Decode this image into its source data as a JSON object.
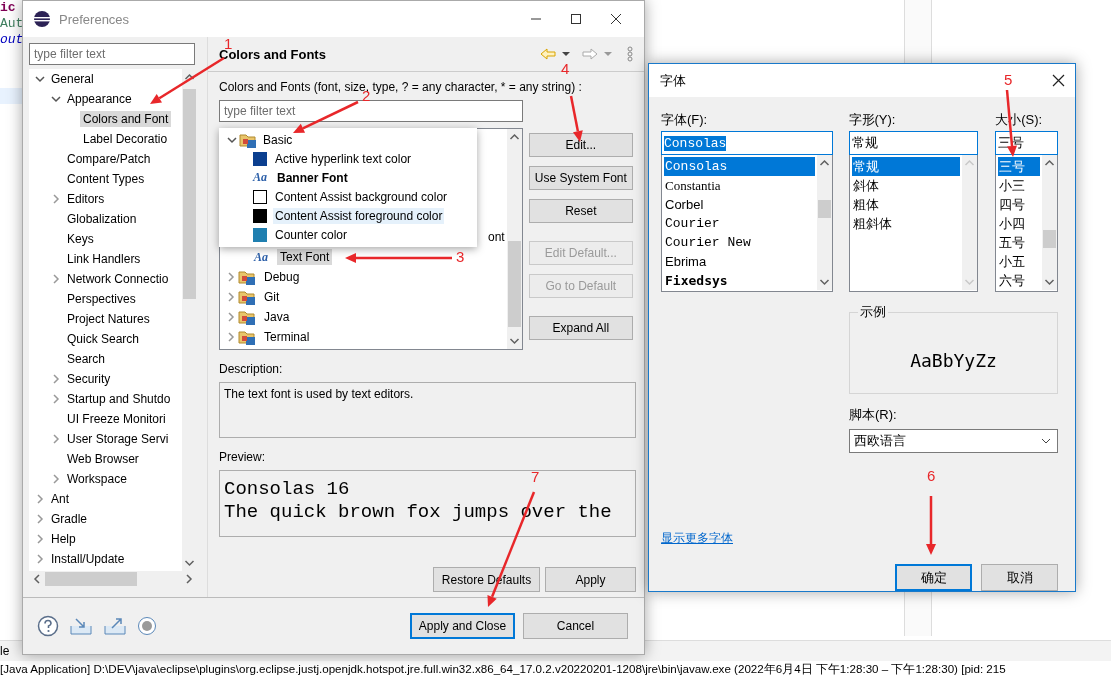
{
  "editor": {
    "code_fragments": [
      {
        "text": "ic",
        "kind": "keyword"
      },
      {
        "text": "Aut",
        "kind": "comment"
      },
      {
        "text": "out",
        "kind": "field"
      }
    ],
    "console_tab": "le",
    "console_line": "[Java Application] D:\\DEV\\java\\eclipse\\plugins\\org.eclipse.justj.openjdk.hotspot.jre.full.win32.x86_64_17.0.2.v20220201-1208\\jre\\bin\\javaw.exe  (2022年6月4日 下午1:28:30 – 下午1:28:30) [pid: 215"
  },
  "preferences": {
    "title": "Preferences",
    "filter": {
      "placeholder": "type filter text"
    },
    "tree": [
      {
        "label": "General",
        "selected": false,
        "expanded": true,
        "children": [
          {
            "label": "Appearance",
            "selected": false,
            "expanded": true,
            "children": [
              {
                "label": "Colors and Font",
                "selected": true
              },
              {
                "label": "Label Decoratio",
                "selected": false
              }
            ]
          },
          {
            "label": "Compare/Patch",
            "selected": false
          },
          {
            "label": "Content Types",
            "selected": false
          },
          {
            "label": "Editors",
            "selected": false,
            "expanded": false
          },
          {
            "label": "Globalization",
            "selected": false
          },
          {
            "label": "Keys",
            "selected": false
          },
          {
            "label": "Link Handlers",
            "selected": false
          },
          {
            "label": "Network Connectio",
            "selected": false,
            "expanded": false
          },
          {
            "label": "Perspectives",
            "selected": false
          },
          {
            "label": "Project Natures",
            "selected": false
          },
          {
            "label": "Quick Search",
            "selected": false
          },
          {
            "label": "Search",
            "selected": false
          },
          {
            "label": "Security",
            "selected": false,
            "expanded": false
          },
          {
            "label": "Startup and Shutdo",
            "selected": false,
            "expanded": false
          },
          {
            "label": "UI Freeze Monitori",
            "selected": false
          },
          {
            "label": "User Storage Servi",
            "selected": false,
            "expanded": false
          },
          {
            "label": "Web Browser",
            "selected": false
          },
          {
            "label": "Workspace",
            "selected": false,
            "expanded": false
          }
        ]
      },
      {
        "label": "Ant",
        "selected": false,
        "expanded": false
      },
      {
        "label": "Gradle",
        "selected": false,
        "expanded": false
      },
      {
        "label": "Help",
        "selected": false,
        "expanded": false
      },
      {
        "label": "Install/Update",
        "selected": false,
        "expanded": false
      }
    ],
    "page": {
      "title": "Colors and Fonts",
      "hint": "Colors and Fonts (font, size, type, ? = any character, * = any string) :",
      "filter": {
        "placeholder": "type filter text"
      },
      "tree": [
        {
          "label": "ont",
          "kind": "fragment"
        },
        {
          "label": "Text Font",
          "kind": "font",
          "glyph": "Aa",
          "selected": true
        },
        {
          "label": "Debug",
          "kind": "category",
          "expanded": false,
          "selected": false
        },
        {
          "label": "Git",
          "kind": "category",
          "expanded": false,
          "selected": false
        },
        {
          "label": "Java",
          "kind": "category",
          "expanded": false,
          "selected": false
        },
        {
          "label": "Terminal",
          "kind": "category",
          "expanded": false,
          "selected": false
        }
      ],
      "popup": [
        {
          "label": "Basic",
          "kind": "category",
          "expanded": true,
          "bold": false,
          "highlighted": false
        },
        {
          "label": "Active hyperlink text color",
          "kind": "color",
          "color": "#0b3f8f",
          "bold": false,
          "highlighted": false
        },
        {
          "label": "Banner Font",
          "kind": "font",
          "glyph": "Aa",
          "bold": true,
          "highlighted": false
        },
        {
          "label": "Content Assist background color",
          "kind": "color",
          "color": "#ffffff",
          "bold": false,
          "highlighted": false
        },
        {
          "label": "Content Assist foreground color",
          "kind": "color",
          "color": "#000000",
          "bold": false,
          "highlighted": true
        },
        {
          "label": "Counter color",
          "kind": "color",
          "color": "#1f7fb0",
          "bold": false,
          "highlighted": false
        }
      ],
      "side_buttons": [
        {
          "label": "Edit...",
          "disabled": false
        },
        {
          "label": "Use System Font",
          "disabled": false
        },
        {
          "label": "Reset",
          "disabled": false
        },
        {
          "label": "Edit Default...",
          "disabled": true
        },
        {
          "label": "Go to Default",
          "disabled": true
        },
        {
          "label": "Expand All",
          "disabled": false
        }
      ],
      "description_label": "Description:",
      "description": "The text font is used by text editors.",
      "preview_label": "Preview:",
      "preview_lines": [
        "Consolas 16",
        "The quick brown fox jumps over the"
      ],
      "buttons": [
        "Restore Defaults",
        "Apply"
      ]
    },
    "buttons": [
      {
        "label": "Apply and Close",
        "default": true
      },
      {
        "label": "Cancel",
        "default": false
      }
    ]
  },
  "font_dialog": {
    "title": "字体",
    "columns": [
      {
        "label": "字体(F):",
        "value": "Consolas",
        "value_selected": true,
        "scrollbar_disabled": false,
        "items": [
          {
            "label": "Consolas",
            "kind": "mono",
            "selected": true
          },
          {
            "label": "Constantia",
            "kind": "serif",
            "selected": false
          },
          {
            "label": "Corbel",
            "kind": "sans",
            "selected": false
          },
          {
            "label": "Courier",
            "kind": "mono",
            "selected": false
          },
          {
            "label": "Courier New",
            "kind": "mono",
            "selected": false
          },
          {
            "label": "Ebrima",
            "kind": "sans",
            "selected": false
          },
          {
            "label": "Fixedsys",
            "kind": "mono-bold",
            "selected": false
          }
        ]
      },
      {
        "label": "字形(Y):",
        "value": "常规",
        "value_selected": false,
        "scrollbar_disabled": true,
        "items": [
          {
            "label": "常规",
            "kind": "sans",
            "selected": true
          },
          {
            "label": "斜体",
            "kind": "sans",
            "selected": false
          },
          {
            "label": "粗体",
            "kind": "sans",
            "selected": false
          },
          {
            "label": "粗斜体",
            "kind": "sans",
            "selected": false
          }
        ]
      },
      {
        "label": "大小(S):",
        "value": "三号",
        "value_selected": false,
        "scrollbar_disabled": false,
        "items": [
          {
            "label": "三号",
            "kind": "sans",
            "selected": true
          },
          {
            "label": "小三",
            "kind": "sans",
            "selected": false
          },
          {
            "label": "四号",
            "kind": "sans",
            "selected": false
          },
          {
            "label": "小四",
            "kind": "sans",
            "selected": false
          },
          {
            "label": "五号",
            "kind": "sans",
            "selected": false
          },
          {
            "label": "小五",
            "kind": "sans",
            "selected": false
          },
          {
            "label": "六号",
            "kind": "sans",
            "selected": false
          }
        ]
      }
    ],
    "sample_label": "示例",
    "sample": "AaBbYyZz",
    "script_label": "脚本(R):",
    "script": "西欧语言",
    "more_fonts_link": "显示更多字体",
    "buttons": [
      {
        "label": "确定",
        "default": true
      },
      {
        "label": "取消",
        "default": false
      }
    ]
  },
  "annotations": [
    "1",
    "2",
    "3",
    "4",
    "5",
    "6",
    "7"
  ]
}
